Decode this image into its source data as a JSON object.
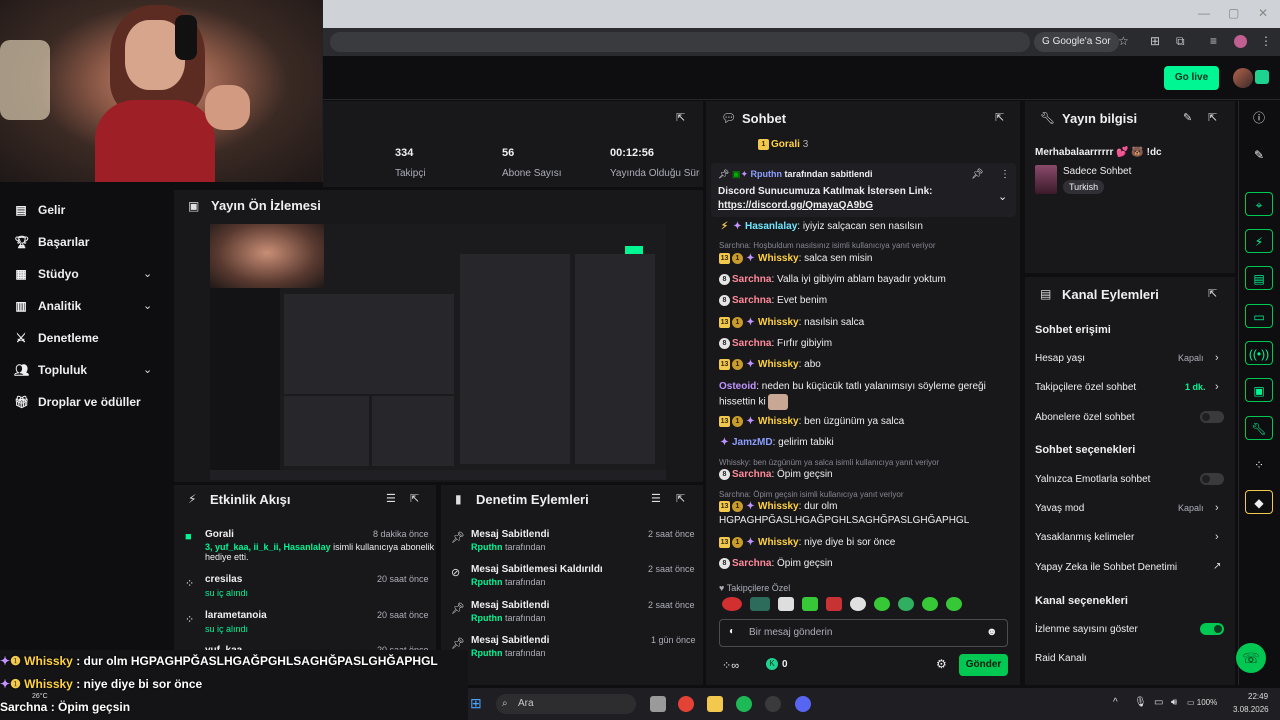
{
  "browser": {
    "google_ask": "Google'a Sor"
  },
  "topbar": {
    "go_live": "Go live"
  },
  "nav": {
    "items": [
      {
        "label": "Gelir",
        "icon": "dollar-icon"
      },
      {
        "label": "Başarılar",
        "icon": "trophy-icon"
      },
      {
        "label": "Stüdyo",
        "icon": "film-icon"
      },
      {
        "label": "Analitik",
        "icon": "chart-icon"
      },
      {
        "label": "Denetleme",
        "icon": "sword-icon"
      },
      {
        "label": "Topluluk",
        "icon": "people-icon"
      },
      {
        "label": "Droplar ve ödüller",
        "icon": "gift-icon"
      }
    ]
  },
  "stats": {
    "followers": {
      "value": "334",
      "label": "Takipçi"
    },
    "subs": {
      "value": "56",
      "label": "Abone Sayısı"
    },
    "uptime": {
      "value": "00:12:56",
      "label": "Yayında Olduğu Süre"
    }
  },
  "preview": {
    "title": "Yayın Ön İzlemesi"
  },
  "activity": {
    "title": "Etkinlik Akışı",
    "items": [
      {
        "name": "Gorali",
        "time": "8 dakika önce",
        "line1_green": "3, yuf_kaa, ii_k_ii, Hasanlalay",
        "line1_rest": " isimli kullanıcıya abonelik",
        "line2": "hediye etti."
      },
      {
        "name": "cresilas",
        "time": "20 saat önce",
        "sub": "su iç alındı"
      },
      {
        "name": "larametanoia",
        "time": "20 saat önce",
        "sub": "su iç alındı"
      },
      {
        "name": "yuf_kaa",
        "time": "20 saat önce"
      }
    ]
  },
  "modactions": {
    "title": "Denetim Eylemleri",
    "items": [
      {
        "title": "Mesaj Sabitlendi",
        "by": "Rputhn",
        "by_suffix": " tarafından",
        "time": "2 saat önce"
      },
      {
        "title": "Mesaj Sabitlemesi Kaldırıldı",
        "by": "Rputhn",
        "by_suffix": " tarafından",
        "time": "2 saat önce"
      },
      {
        "title": "Mesaj Sabitlendi",
        "by": "Rputhn",
        "by_suffix": " tarafından",
        "time": "2 saat önce"
      },
      {
        "title": "Mesaj Sabitlendi",
        "by": "Rputhn",
        "by_suffix": " tarafından",
        "time": "1 gün önce"
      }
    ]
  },
  "chat": {
    "title": "Sohbet",
    "hype_user": "Gorali",
    "hype_count": "3",
    "pinned_by": "Rputhn",
    "pinned_suffix": " tarafından sabitlendi",
    "pinned_text": "Discord Sunucumuza Katılmak İstersen Link:",
    "pinned_link": "https://discord.gg/QmayaQA9bG",
    "messages": [
      {
        "user": "Hasanlalay",
        "text": " iyiyiz salçacan sen nasılsın"
      },
      {
        "reply": "Sarchna: Hoşbuldum nasılsınız isimli kullanıcıya yanıt veriyor"
      },
      {
        "user": "Whissky",
        "text": " salca sen misin"
      },
      {
        "user": "Sarchna",
        "text": " Valla iyi gibiyim ablam bayadır yoktum"
      },
      {
        "user": "Sarchna",
        "text": " Evet benim"
      },
      {
        "user": "Whissky",
        "text": " nasılsin salca"
      },
      {
        "user": "Sarchna",
        "text": " Fırfır gibiyim"
      },
      {
        "user": "Whissky",
        "text": " abo"
      },
      {
        "user": "Osteoid",
        "text": " neden bu küçücük tatlı yalanımsıyı söyleme gereği hissettin ki"
      },
      {
        "user": "Whissky",
        "text": " ben üzgünüm ya salca"
      },
      {
        "user": "JamzMD",
        "text": " gelirim tabiki"
      },
      {
        "reply": "Whissky: ben üzgünüm ya salca isimli kullanıcıya yanıt veriyor"
      },
      {
        "user": "Sarchna",
        "text": " Öpim geçsin"
      },
      {
        "reply": "Sarchna: Öpim geçsin isimli kullanıcıya yanıt veriyor"
      },
      {
        "user": "Whissky",
        "text": " dur olm HGPAGHPĞASLHGAĞPGHLSAGHĞPASLGHĞAPHGL"
      },
      {
        "user": "Whissky",
        "text": " niye diye bi sor önce"
      },
      {
        "user": "Sarchna",
        "text": " Öpim geçsin"
      }
    ],
    "followers_only": "Takipçilere Özel",
    "input_placeholder": "Bir mesaj gönderin",
    "points": "0",
    "send": "Gönder"
  },
  "streaminfo": {
    "title": "Yayın bilgisi",
    "stream_title": "Merhabalaarrrrrr 💕 🐻 !dc",
    "category": "Sadece Sohbet",
    "tag": "Turkish"
  },
  "channelactions": {
    "title": "Kanal Eylemleri",
    "chat_access": "Sohbet erişimi",
    "account_age": "Hesap yaşı",
    "account_age_val": "Kapalı",
    "followers_chat": "Takipçilere özel sohbet",
    "followers_chat_val": "1 dk.",
    "subs_chat": "Abonelere özel sohbet",
    "chat_options": "Sohbet seçenekleri",
    "emote_only": "Yalnızca Emotlarla sohbet",
    "slow_mode": "Yavaş mod",
    "slow_mode_val": "Kapalı",
    "banned_words": "Yasaklanmış kelimeler",
    "ai_mod": "Yapay Zeka ile Sohbet Denetimi",
    "channel_options": "Kanal seçenekleri",
    "show_viewers": "İzlenme sayısını göster",
    "raid": "Raid Kanalı"
  },
  "overlay": {
    "lines": [
      {
        "user": "Whissky",
        "text": " : dur olm HGPAGHPĞASLHGAĞPGHLSAGHĞPASLGHĞAPHGL"
      },
      {
        "user": "Whissky",
        "text": " : niye diye bi sor önce"
      },
      {
        "user": "Sarchna",
        "text": " : Öpim geçsin"
      }
    ],
    "temp": "26°C"
  },
  "taskbar": {
    "search": "Ara",
    "battery": "100%",
    "time": "22:49",
    "date": "3.08.2026"
  },
  "colors": {
    "accent_green": "#00f593",
    "panel_bg": "#18181b",
    "page_bg": "#0e0e10",
    "sub_purple": "#bf94ff"
  }
}
